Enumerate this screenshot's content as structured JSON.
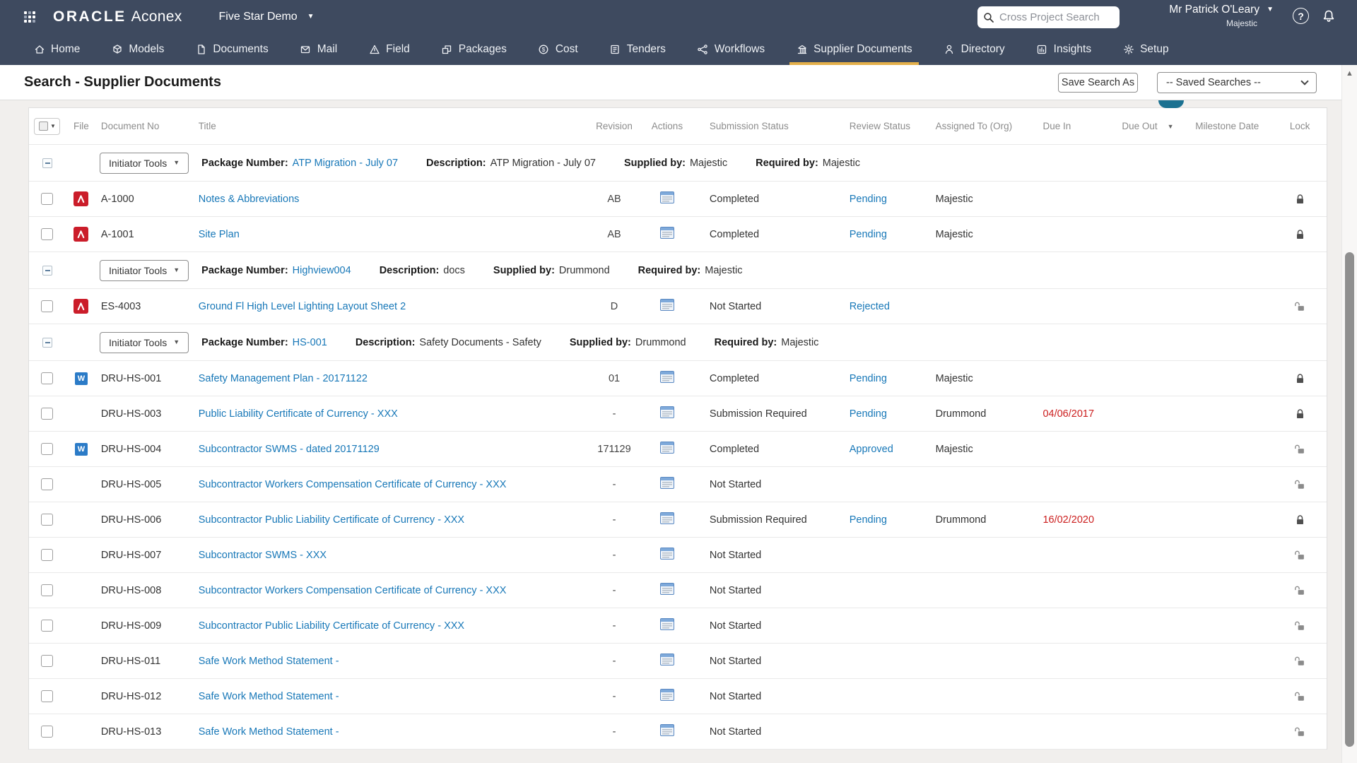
{
  "topbar": {
    "brand": {
      "oracle": "ORACLE",
      "product": "Aconex"
    },
    "project_selector": "Five Star Demo",
    "search_placeholder": "Cross Project Search",
    "user": {
      "name": "Mr Patrick O'Leary",
      "org": "Majestic"
    },
    "help_glyph": "?"
  },
  "nav": {
    "items": [
      {
        "label": "Home",
        "icon": "home"
      },
      {
        "label": "Models",
        "icon": "models"
      },
      {
        "label": "Documents",
        "icon": "documents"
      },
      {
        "label": "Mail",
        "icon": "mail"
      },
      {
        "label": "Field",
        "icon": "field"
      },
      {
        "label": "Packages",
        "icon": "packages"
      },
      {
        "label": "Cost",
        "icon": "cost"
      },
      {
        "label": "Tenders",
        "icon": "tenders"
      },
      {
        "label": "Workflows",
        "icon": "workflows"
      },
      {
        "label": "Supplier Documents",
        "icon": "supplier-documents",
        "active": true
      },
      {
        "label": "Directory",
        "icon": "directory"
      },
      {
        "label": "Insights",
        "icon": "insights"
      },
      {
        "label": "Setup",
        "icon": "setup"
      }
    ]
  },
  "page": {
    "title": "Search - Supplier Documents",
    "save_search_button": "Save Search As",
    "saved_searches_placeholder": "-- Saved Searches --"
  },
  "table": {
    "columns": [
      {
        "label": "File"
      },
      {
        "label": "Document No"
      },
      {
        "label": "Title"
      },
      {
        "label": "Revision"
      },
      {
        "label": "Actions"
      },
      {
        "label": "Submission Status"
      },
      {
        "label": "Review Status"
      },
      {
        "label": "Assigned To (Org)"
      },
      {
        "label": "Due In"
      },
      {
        "label": "Due Out",
        "sort": "desc"
      },
      {
        "label": "Milestone Date"
      },
      {
        "label": "Lock"
      }
    ],
    "group_labels": {
      "button": "Initiator Tools",
      "package_number": "Package Number:",
      "description": "Description:",
      "supplied_by": "Supplied by:",
      "required_by": "Required by:"
    },
    "rows": [
      {
        "type": "group",
        "package_number": "ATP Migration - July 07",
        "description": "ATP Migration - July 07",
        "supplied_by": "Majestic",
        "required_by": "Majestic"
      },
      {
        "type": "doc",
        "file": "pdf",
        "doc_no": "A-1000",
        "title": "Notes & Abbreviations",
        "revision": "AB",
        "submission_status": "Completed",
        "review_status": "Pending",
        "assigned_to": "Majestic",
        "lock": "locked"
      },
      {
        "type": "doc",
        "file": "pdf",
        "doc_no": "A-1001",
        "title": "Site Plan",
        "revision": "AB",
        "submission_status": "Completed",
        "review_status": "Pending",
        "assigned_to": "Majestic",
        "lock": "locked"
      },
      {
        "type": "group",
        "package_number": "Highview004",
        "description": "docs",
        "supplied_by": "Drummond",
        "required_by": "Majestic"
      },
      {
        "type": "doc",
        "file": "pdf",
        "doc_no": "ES-4003",
        "title": "Ground Fl High Level Lighting Layout Sheet 2",
        "revision": "D",
        "submission_status": "Not Started",
        "review_status": "Rejected",
        "lock": "unlocked"
      },
      {
        "type": "group",
        "package_number": "HS-001",
        "description": "Safety Documents - Safety",
        "supplied_by": "Drummond",
        "required_by": "Majestic"
      },
      {
        "type": "doc",
        "file": "word",
        "doc_no": "DRU-HS-001",
        "title": "Safety Management Plan - 20171122",
        "revision": "01",
        "submission_status": "Completed",
        "review_status": "Pending",
        "assigned_to": "Majestic",
        "lock": "locked"
      },
      {
        "type": "doc",
        "file": "",
        "doc_no": "DRU-HS-003",
        "title": "Public Liability Certificate of Currency - XXX",
        "revision": "-",
        "submission_status": "Submission Required",
        "review_status": "Pending",
        "assigned_to": "Drummond",
        "due_in": "04/06/2017",
        "lock": "locked"
      },
      {
        "type": "doc",
        "file": "word",
        "doc_no": "DRU-HS-004",
        "title": "Subcontractor SWMS - dated 20171129",
        "revision": "171129",
        "submission_status": "Completed",
        "review_status": "Approved",
        "assigned_to": "Majestic",
        "lock": "unlocked"
      },
      {
        "type": "doc",
        "file": "",
        "doc_no": "DRU-HS-005",
        "title": "Subcontractor Workers Compensation Certificate of Currency - XXX",
        "revision": "-",
        "submission_status": "Not Started",
        "lock": "unlocked"
      },
      {
        "type": "doc",
        "file": "",
        "doc_no": "DRU-HS-006",
        "title": "Subcontractor Public Liability Certificate of Currency - XXX",
        "revision": "-",
        "submission_status": "Submission Required",
        "review_status": "Pending",
        "assigned_to": "Drummond",
        "due_in": "16/02/2020",
        "lock": "locked"
      },
      {
        "type": "doc",
        "file": "",
        "doc_no": "DRU-HS-007",
        "title": "Subcontractor SWMS - XXX",
        "revision": "-",
        "submission_status": "Not Started",
        "lock": "unlocked"
      },
      {
        "type": "doc",
        "file": "",
        "doc_no": "DRU-HS-008",
        "title": "Subcontractor Workers Compensation Certificate of Currency - XXX",
        "revision": "-",
        "submission_status": "Not Started",
        "lock": "unlocked"
      },
      {
        "type": "doc",
        "file": "",
        "doc_no": "DRU-HS-009",
        "title": "Subcontractor Public Liability Certificate of Currency - XXX",
        "revision": "-",
        "submission_status": "Not Started",
        "lock": "unlocked"
      },
      {
        "type": "doc",
        "file": "",
        "doc_no": "DRU-HS-011",
        "title": "Safe Work Method Statement -",
        "revision": "-",
        "submission_status": "Not Started",
        "lock": "unlocked"
      },
      {
        "type": "doc",
        "file": "",
        "doc_no": "DRU-HS-012",
        "title": "Safe Work Method Statement -",
        "revision": "-",
        "submission_status": "Not Started",
        "lock": "unlocked"
      },
      {
        "type": "doc",
        "file": "",
        "doc_no": "DRU-HS-013",
        "title": "Safe Work Method Statement -",
        "revision": "-",
        "submission_status": "Not Started",
        "lock": "unlocked"
      }
    ]
  },
  "colors": {
    "topbar_bg": "#3e4a5f",
    "active_tab_underline": "#e4b04a",
    "link_blue": "#1878b8",
    "overdue_red": "#cc1f1f",
    "collapse_handle": "#1b7191"
  }
}
